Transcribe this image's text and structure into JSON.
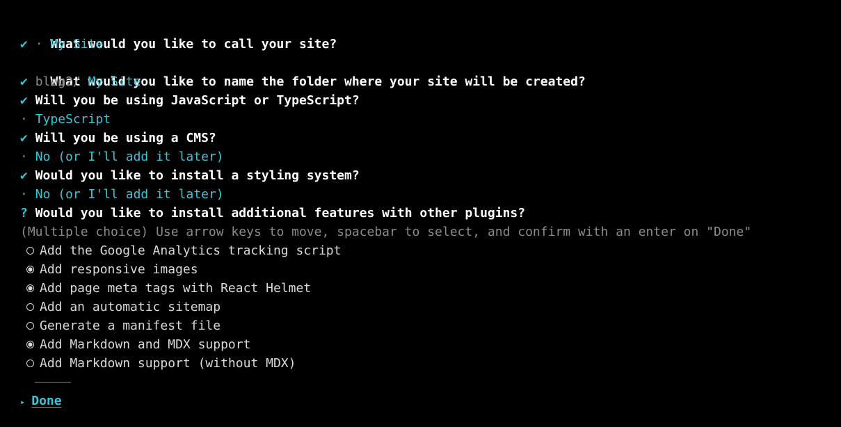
{
  "prompts": {
    "site_name_question": "What would you like to call your site?",
    "site_name_check": "✔",
    "site_name_sep": "·",
    "site_name_answer": "My Site",
    "folder_question": "What would you like to name the folder where your site will be created?",
    "folder_check": "✔",
    "folder_prefix": "blog2/",
    "folder_answer": "My Site",
    "lang_check": "✔",
    "lang_question": "Will you be using JavaScript or TypeScript?",
    "lang_sep": "·",
    "lang_answer": "TypeScript",
    "cms_check": "✔",
    "cms_question": "Will you be using a CMS?",
    "cms_sep": "·",
    "cms_answer": "No (or I'll add it later)",
    "styling_check": "✔",
    "styling_question": "Would you like to install a styling system?",
    "styling_sep": "·",
    "styling_answer": "No (or I'll add it later)",
    "features_mark": "?",
    "features_question": "Would you like to install additional features with other plugins?",
    "features_hint": "(Multiple choice) Use arrow keys to move, spacebar to select, and confirm with an enter on \"Done\""
  },
  "options": [
    {
      "label": "Add the Google Analytics tracking script",
      "selected": false
    },
    {
      "label": "Add responsive images",
      "selected": true
    },
    {
      "label": "Add page meta tags with React Helmet",
      "selected": true
    },
    {
      "label": "Add an automatic sitemap",
      "selected": false
    },
    {
      "label": "Generate a manifest file",
      "selected": false
    },
    {
      "label": "Add Markdown and MDX support",
      "selected": true
    },
    {
      "label": "Add Markdown support (without MDX)",
      "selected": false
    }
  ],
  "done": {
    "arrow": "▸",
    "label": "Done"
  },
  "colors": {
    "background": "#000000",
    "accent": "#35c7d9",
    "text": "#d9d9d9",
    "muted": "#8b8b8b"
  }
}
